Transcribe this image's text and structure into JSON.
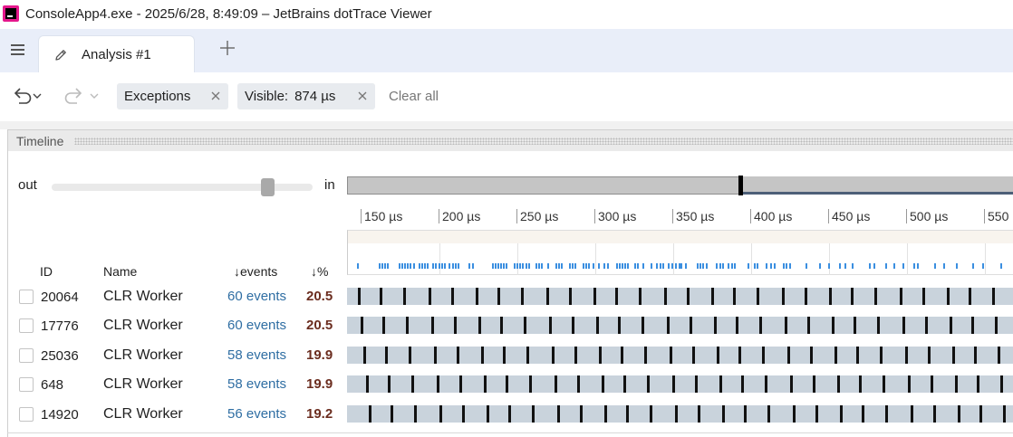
{
  "window": {
    "title": "ConsoleApp4.exe - 2025/6/28, 8:49:09 – JetBrains dotTrace Viewer",
    "logo_icon": "dottrace-logo-icon"
  },
  "tabs": [
    {
      "label": "Analysis #1",
      "icon": "pencil-icon"
    }
  ],
  "toolbar": {
    "filters": [
      {
        "label": "Exceptions"
      },
      {
        "label": "Visible:",
        "value": "874 µs"
      }
    ],
    "clear_all": "Clear all"
  },
  "timeline": {
    "title": "Timeline",
    "zoom": {
      "out_label": "out",
      "in_label": "in",
      "level": 0.84
    },
    "ruler_ticks": [
      "150 µs",
      "200 µs",
      "250 µs",
      "300 µs",
      "350 µs",
      "400 µs",
      "450 µs",
      "500 µs",
      "550"
    ],
    "columns": {
      "id": "ID",
      "name": "Name",
      "events": "↓events",
      "pct": "↓%"
    },
    "threads": [
      {
        "id": "20064",
        "name": "CLR Worker",
        "events": "60 events",
        "pct": "20.5"
      },
      {
        "id": "17776",
        "name": "CLR Worker",
        "events": "60 events",
        "pct": "20.5"
      },
      {
        "id": "25036",
        "name": "CLR Worker",
        "events": "58 events",
        "pct": "19.9"
      },
      {
        "id": "648",
        "name": "CLR Worker",
        "events": "58 events",
        "pct": "19.9"
      },
      {
        "id": "14920",
        "name": "CLR Worker",
        "events": "56 events",
        "pct": "19.2"
      }
    ]
  },
  "colors": {
    "accent": "#2f6ea3",
    "percent": "#6b2d1f",
    "event_mark": "#3b8fe0",
    "lane": "#c9d3dc"
  }
}
